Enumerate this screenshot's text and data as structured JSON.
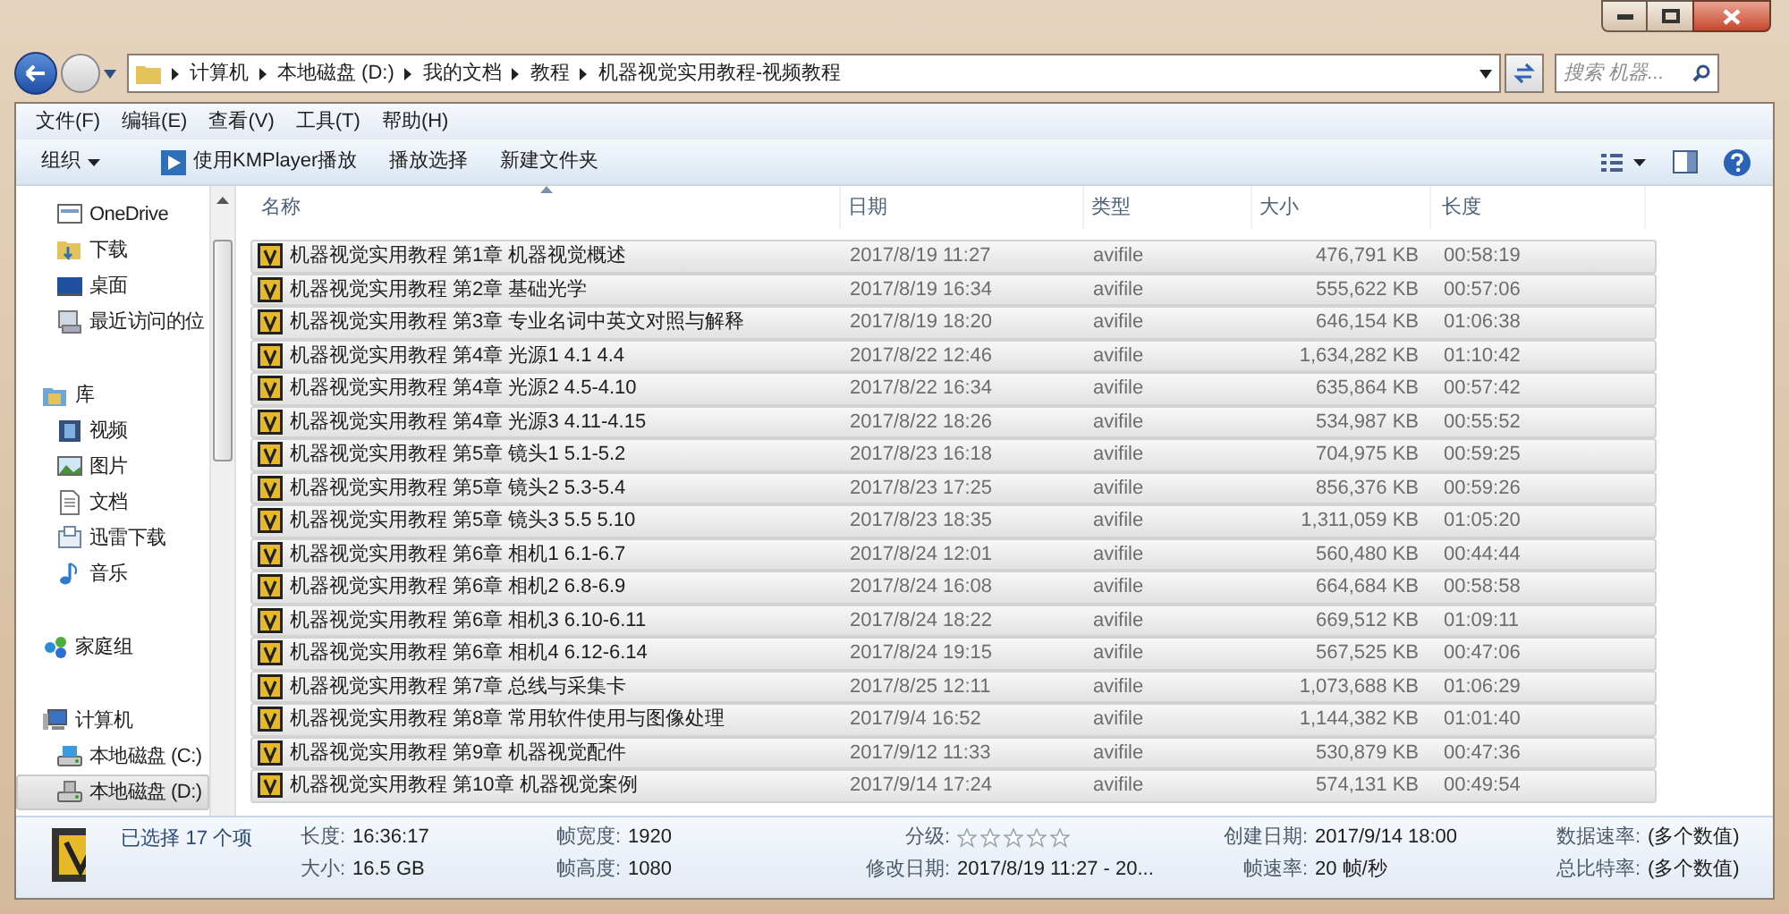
{
  "address_bar": {
    "crumbs": [
      "计算机",
      "本地磁盘 (D:)",
      "我的文档",
      "教程",
      "机器视觉实用教程-视频教程"
    ]
  },
  "search": {
    "placeholder": "搜索 机器..."
  },
  "menu": [
    "文件(F)",
    "编辑(E)",
    "查看(V)",
    "工具(T)",
    "帮助(H)"
  ],
  "toolbar": [
    {
      "label": "组织",
      "kind": "dropdown"
    },
    {
      "label": "使用KMPlayer播放",
      "kind": "app"
    },
    {
      "label": "播放选择",
      "kind": "plain"
    },
    {
      "label": "新建文件夹",
      "kind": "plain"
    }
  ],
  "nav": {
    "items": [
      {
        "label": "OneDrive",
        "kind": "item",
        "selected": false
      },
      {
        "label": "下载",
        "kind": "item",
        "selected": false
      },
      {
        "label": "桌面",
        "kind": "item",
        "selected": false
      },
      {
        "label": "最近访问的位",
        "kind": "item",
        "selected": false
      },
      {
        "label": "库",
        "kind": "group",
        "selected": false,
        "children": [
          {
            "label": "视频",
            "kind": "item",
            "selected": false
          },
          {
            "label": "图片",
            "kind": "item",
            "selected": false
          },
          {
            "label": "文档",
            "kind": "item",
            "selected": false
          },
          {
            "label": "迅雷下载",
            "kind": "item",
            "selected": false
          },
          {
            "label": "音乐",
            "kind": "item",
            "selected": false
          }
        ]
      },
      {
        "label": "家庭组",
        "kind": "group",
        "selected": false
      },
      {
        "label": "计算机",
        "kind": "group",
        "selected": false,
        "children": [
          {
            "label": "本地磁盘 (C:)",
            "kind": "item",
            "selected": false
          },
          {
            "label": "本地磁盘 (D:)",
            "kind": "item",
            "selected": true
          }
        ]
      }
    ]
  },
  "table": {
    "columns": [
      "名称",
      "日期",
      "类型",
      "大小",
      "长度"
    ],
    "rows": [
      {
        "name": "机器视觉实用教程 第1章 机器视觉概述",
        "date": "2017/8/19 11:27",
        "type": "avifile",
        "size": "476,791 KB",
        "length": "00:58:19",
        "selected": true
      },
      {
        "name": "机器视觉实用教程 第2章 基础光学",
        "date": "2017/8/19 16:34",
        "type": "avifile",
        "size": "555,622 KB",
        "length": "00:57:06",
        "selected": true
      },
      {
        "name": "机器视觉实用教程 第3章 专业名词中英文对照与解释",
        "date": "2017/8/19 18:20",
        "type": "avifile",
        "size": "646,154 KB",
        "length": "01:06:38",
        "selected": true
      },
      {
        "name": "机器视觉实用教程 第4章 光源1 4.1 4.4",
        "date": "2017/8/22 12:46",
        "type": "avifile",
        "size": "1,634,282 KB",
        "length": "01:10:42",
        "selected": true
      },
      {
        "name": "机器视觉实用教程 第4章 光源2 4.5-4.10",
        "date": "2017/8/22 16:34",
        "type": "avifile",
        "size": "635,864 KB",
        "length": "00:57:42",
        "selected": true
      },
      {
        "name": "机器视觉实用教程 第4章 光源3 4.11-4.15",
        "date": "2017/8/22 18:26",
        "type": "avifile",
        "size": "534,987 KB",
        "length": "00:55:52",
        "selected": true
      },
      {
        "name": "机器视觉实用教程 第5章 镜头1 5.1-5.2",
        "date": "2017/8/23 16:18",
        "type": "avifile",
        "size": "704,975 KB",
        "length": "00:59:25",
        "selected": true
      },
      {
        "name": "机器视觉实用教程 第5章 镜头2 5.3-5.4",
        "date": "2017/8/23 17:25",
        "type": "avifile",
        "size": "856,376 KB",
        "length": "00:59:26",
        "selected": true
      },
      {
        "name": "机器视觉实用教程 第5章 镜头3 5.5 5.10",
        "date": "2017/8/23 18:35",
        "type": "avifile",
        "size": "1,311,059 KB",
        "length": "01:05:20",
        "selected": true
      },
      {
        "name": "机器视觉实用教程 第6章 相机1 6.1-6.7",
        "date": "2017/8/24 12:01",
        "type": "avifile",
        "size": "560,480 KB",
        "length": "00:44:44",
        "selected": true
      },
      {
        "name": "机器视觉实用教程 第6章 相机2 6.8-6.9",
        "date": "2017/8/24 16:08",
        "type": "avifile",
        "size": "664,684 KB",
        "length": "00:58:58",
        "selected": true
      },
      {
        "name": "机器视觉实用教程 第6章 相机3 6.10-6.11",
        "date": "2017/8/24 18:22",
        "type": "avifile",
        "size": "669,512 KB",
        "length": "01:09:11",
        "selected": true
      },
      {
        "name": "机器视觉实用教程 第6章 相机4 6.12-6.14",
        "date": "2017/8/24 19:15",
        "type": "avifile",
        "size": "567,525 KB",
        "length": "00:47:06",
        "selected": true
      },
      {
        "name": "机器视觉实用教程 第7章 总线与采集卡",
        "date": "2017/8/25 12:11",
        "type": "avifile",
        "size": "1,073,688 KB",
        "length": "01:06:29",
        "selected": true
      },
      {
        "name": "机器视觉实用教程 第8章 常用软件使用与图像处理",
        "date": "2017/9/4 16:52",
        "type": "avifile",
        "size": "1,144,382 KB",
        "length": "01:01:40",
        "selected": true
      },
      {
        "name": "机器视觉实用教程 第9章 机器视觉配件",
        "date": "2017/9/12 11:33",
        "type": "avifile",
        "size": "530,879 KB",
        "length": "00:47:36",
        "selected": true
      },
      {
        "name": "机器视觉实用教程 第10章 机器视觉案例",
        "date": "2017/9/14 17:24",
        "type": "avifile",
        "size": "574,131 KB",
        "length": "00:49:54",
        "selected": true
      }
    ]
  },
  "status_bar": {
    "summary": "已选择 17 个项",
    "columns": [
      [
        {
          "label": "长度:",
          "value": "16:36:17",
          "kind": "text"
        },
        {
          "label": "大小:",
          "value": "16.5 GB",
          "kind": "text"
        }
      ],
      [
        {
          "label": "帧宽度:",
          "value": "1920",
          "kind": "text"
        },
        {
          "label": "帧高度:",
          "value": "1080",
          "kind": "text"
        }
      ],
      [
        {
          "label": "分级:",
          "stars": 0,
          "kind": "rating"
        },
        {
          "label": "修改日期:",
          "value": "2017/8/19 11:27 - 20...",
          "kind": "text"
        }
      ],
      [
        {
          "label": "创建日期:",
          "value": "2017/9/14 18:00",
          "kind": "text"
        },
        {
          "label": "帧速率:",
          "value": "20 帧/秒",
          "kind": "text"
        }
      ],
      [
        {
          "label": "数据速率:",
          "value": "(多个数值)",
          "kind": "text"
        },
        {
          "label": "总比特率:",
          "value": "(多个数值)",
          "kind": "text"
        }
      ]
    ]
  }
}
